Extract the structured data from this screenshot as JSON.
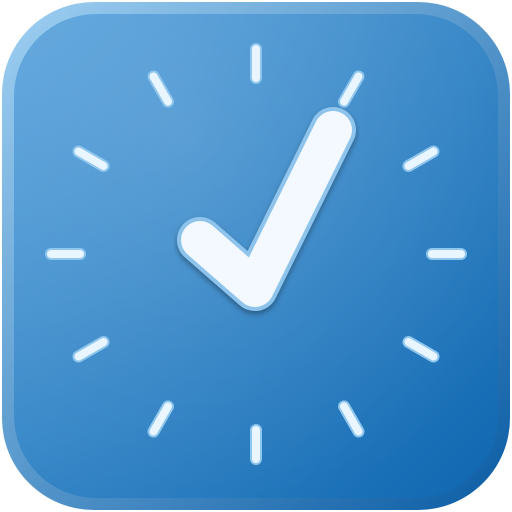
{
  "app_icon": {
    "icon": "clock-checkmark-icon",
    "tick_count": 12,
    "colors": {
      "background_top": "#5ba4dd",
      "background_bottom": "#0f67b0",
      "rim_light": "#9fd0f2",
      "rim_dark": "#0b5ca4",
      "tick": "#eaf6ff",
      "tick_outline": "#8fc6ee",
      "checkmark": "#f3f9ff",
      "checkmark_outline": "#8ec4ec"
    }
  }
}
